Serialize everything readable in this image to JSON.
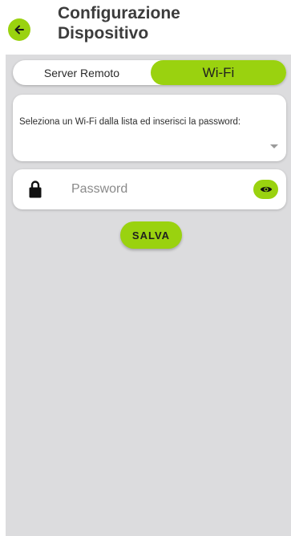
{
  "header": {
    "title_line1": "Configurazione",
    "title_line2": "Dispositivo",
    "back_icon": "arrow-left-icon"
  },
  "tabs": {
    "items": [
      {
        "label": "Server Remoto",
        "selected": false
      },
      {
        "label": "Wi-Fi",
        "selected": true
      }
    ]
  },
  "wifi": {
    "instruction": "Seleziona un Wi-Fi dalla lista ed inserisci la password:",
    "dropdown_icon": "caret-down-icon"
  },
  "password": {
    "placeholder": "Password",
    "value": "",
    "lock_icon": "lock-icon",
    "visibility_icon": "eye-icon"
  },
  "actions": {
    "save_label": "SALVA"
  },
  "colors": {
    "accent": "#9ad20f",
    "background": "#dcdcde",
    "card": "#ffffff",
    "title": "#3c3c3c"
  }
}
